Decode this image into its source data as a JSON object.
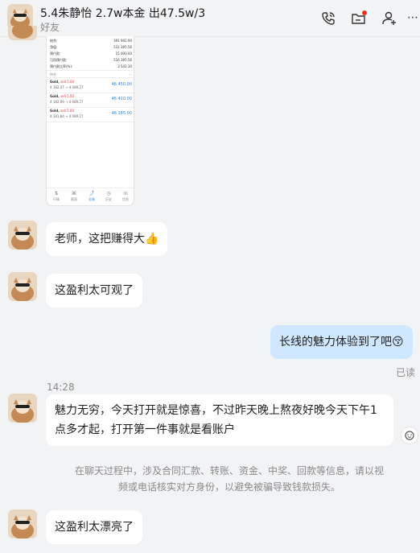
{
  "header": {
    "title": "5.4朱静怡 2.7w本金 出47.5w/3",
    "subtitle": "好友"
  },
  "phone": {
    "rows": [
      {
        "label": "结余:",
        "value": "391 942.90"
      },
      {
        "label": "净值:",
        "value": "531 395.56"
      },
      {
        "label": "预付款:",
        "value": "15 000.00"
      },
      {
        "label": "可用预付款:",
        "value": "516 395.56"
      },
      {
        "label": "预付款比率(%):",
        "value": "3 542.30"
      }
    ],
    "section": "持仓",
    "section_more": "···",
    "trades": [
      {
        "symbol": "Gold,",
        "side": "sell 5.00",
        "range": "4 182.27 → 4 089.27",
        "price": "46 450.00"
      },
      {
        "symbol": "Gold,",
        "side": "sell 5.00",
        "range": "4 182.09 → 4 089.27",
        "price": "46 410.00"
      },
      {
        "symbol": "Gold,",
        "side": "sell 5.00",
        "range": "4 181.84 → 4 089.27",
        "price": "46 285.00"
      }
    ],
    "nav": [
      "行情",
      "图表",
      "交易",
      "历史",
      "信息"
    ],
    "nav_icons": [
      "⇅",
      "⌘",
      "⤴",
      "◷",
      "☏"
    ]
  },
  "messages": {
    "m1": "老师，这把赚得大👍",
    "m2": "这盈利太可观了",
    "m3": "长线的魅力体验到了吧😚",
    "read": "已读",
    "time": "14:28",
    "m4_line1": "魅力无穷，今天打开就是惊喜，不过昨天晚上熬夜好晚今天下午1",
    "m4_line2": "点多才起，打开第一件事就是看账户",
    "notice_line1": "在聊天过程中，涉及合同汇款、转账、资金、中奖、回款等信息，请以视",
    "notice_line2": "频或电话核实对方身份，以避免被骗导致钱款损失。",
    "m5": "这盈利太漂亮了"
  },
  "colors": {
    "background": "#f2f3f5",
    "incoming_bubble": "#ffffff",
    "outgoing_bubble": "#cfe8ff",
    "accent_blue": "#2f7de1",
    "unread_dot": "#e5332a"
  }
}
